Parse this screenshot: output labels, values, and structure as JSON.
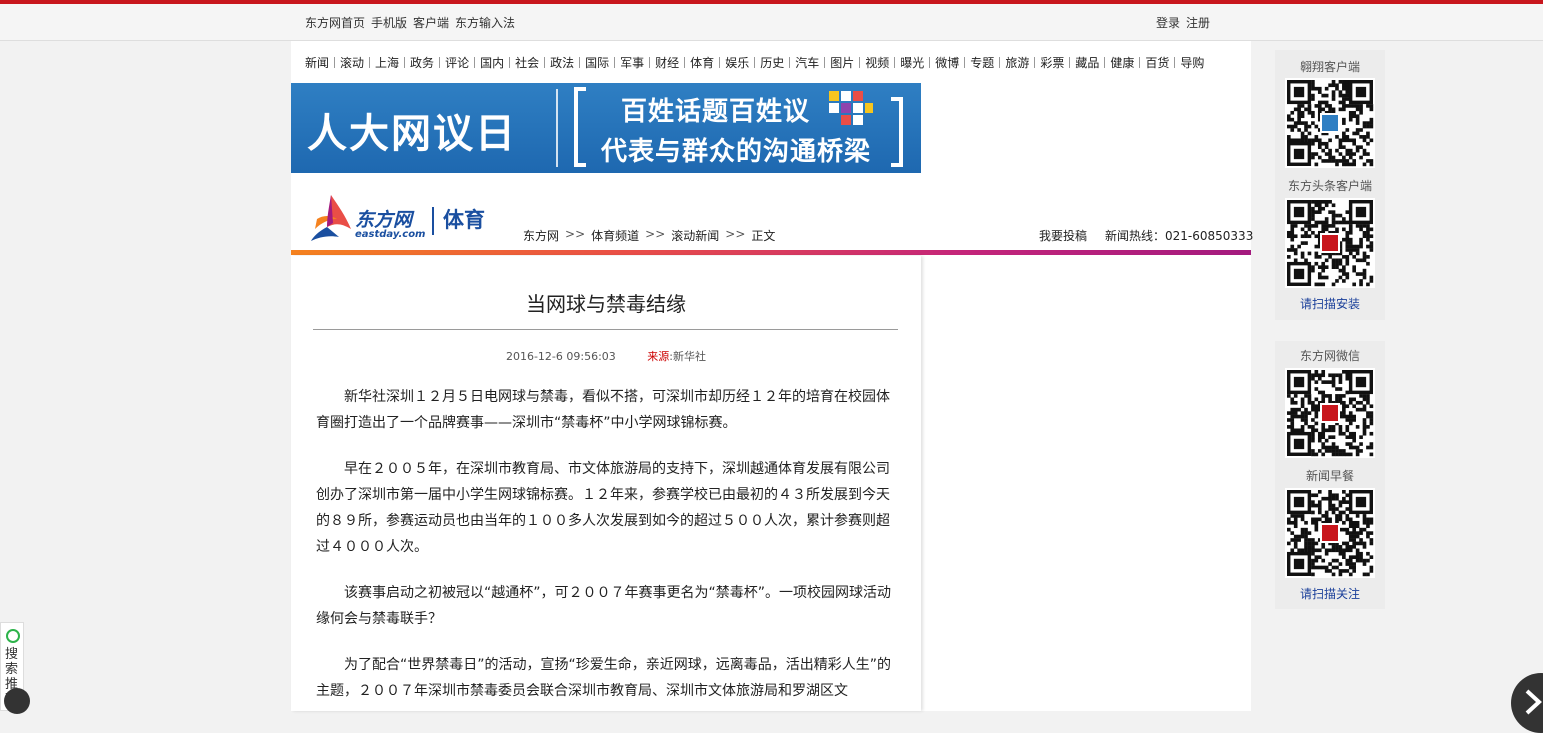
{
  "topbar": {
    "left_links": [
      "东方网首页",
      "手机版",
      "客户端",
      "东方输入法"
    ],
    "right_links": [
      "登录",
      "注册"
    ]
  },
  "nav": {
    "groups": [
      [
        "新闻"
      ],
      [
        "滚动",
        "上海",
        "政务"
      ],
      [
        "评论",
        "国内"
      ],
      [
        "社会",
        "政法",
        "国际"
      ],
      [
        "军事",
        "财经"
      ],
      [
        "体育",
        "娱乐"
      ],
      [
        "历史",
        "汽车"
      ],
      [
        "图片",
        "视频"
      ],
      [
        "曝光",
        "微博"
      ],
      [
        "专题",
        "旅游"
      ],
      [
        "彩票",
        "藏品"
      ],
      [
        "健康",
        "百货"
      ],
      [
        "导购"
      ]
    ]
  },
  "banner": {
    "left_title": "人大网议日",
    "line1": "百姓话题百姓议",
    "line2": "代表与群众的沟通桥梁"
  },
  "header": {
    "logo_name": "东方网",
    "logo_domain": "eastday.com",
    "section": "体育",
    "breadcrumb": [
      "东方网",
      "体育频道",
      "滚动新闻",
      "正文"
    ],
    "breadcrumb_sep": ">>",
    "submit_label": "我要投稿",
    "hotline": "新闻热线：021-60850333"
  },
  "article": {
    "title": "当网球与禁毒结缘",
    "datetime": "2016-12-6 09:56:03",
    "source_label": "来源",
    "source": ":新华社",
    "paragraphs": [
      "新华社深圳１２月５日电网球与禁毒，看似不搭，可深圳市却历经１２年的培育在校园体育圈打造出了一个品牌赛事——深圳市“禁毒杯”中小学网球锦标赛。",
      "早在２００５年，在深圳市教育局、市文体旅游局的支持下，深圳越通体育发展有限公司创办了深圳市第一届中小学生网球锦标赛。１２年来，参赛学校已由最初的４３所发展到今天的８９所，参赛运动员也由当年的１００多人次发展到如今的超过５００人次，累计参赛则超过４０００人次。",
      "该赛事启动之初被冠以“越通杯”，可２００７年赛事更名为“禁毒杯”。一项校园网球活动缘何会与禁毒联手？",
      "为了配合“世界禁毒日”的活动，宣扬“珍爱生命，亲近网球，远离毒品，活出精彩人生”的主题，２００７年深圳市禁毒委员会联合深圳市教育局、深圳市文体旅游局和罗湖区文"
    ]
  },
  "sidebar": {
    "box1": {
      "label1": "翱翔客户端",
      "label2": "东方头条客户端",
      "link": "请扫描安装"
    },
    "box2": {
      "label1": "东方网微信",
      "label2": "新闻早餐",
      "link": "请扫描关注"
    }
  },
  "float": {
    "search_rec": "搜索推荐"
  },
  "colors": {
    "top_strip": "#c8161d",
    "brand_blue": "#1a4fa0",
    "source_red": "#cc0000",
    "link_blue": "#1a3f9a"
  }
}
